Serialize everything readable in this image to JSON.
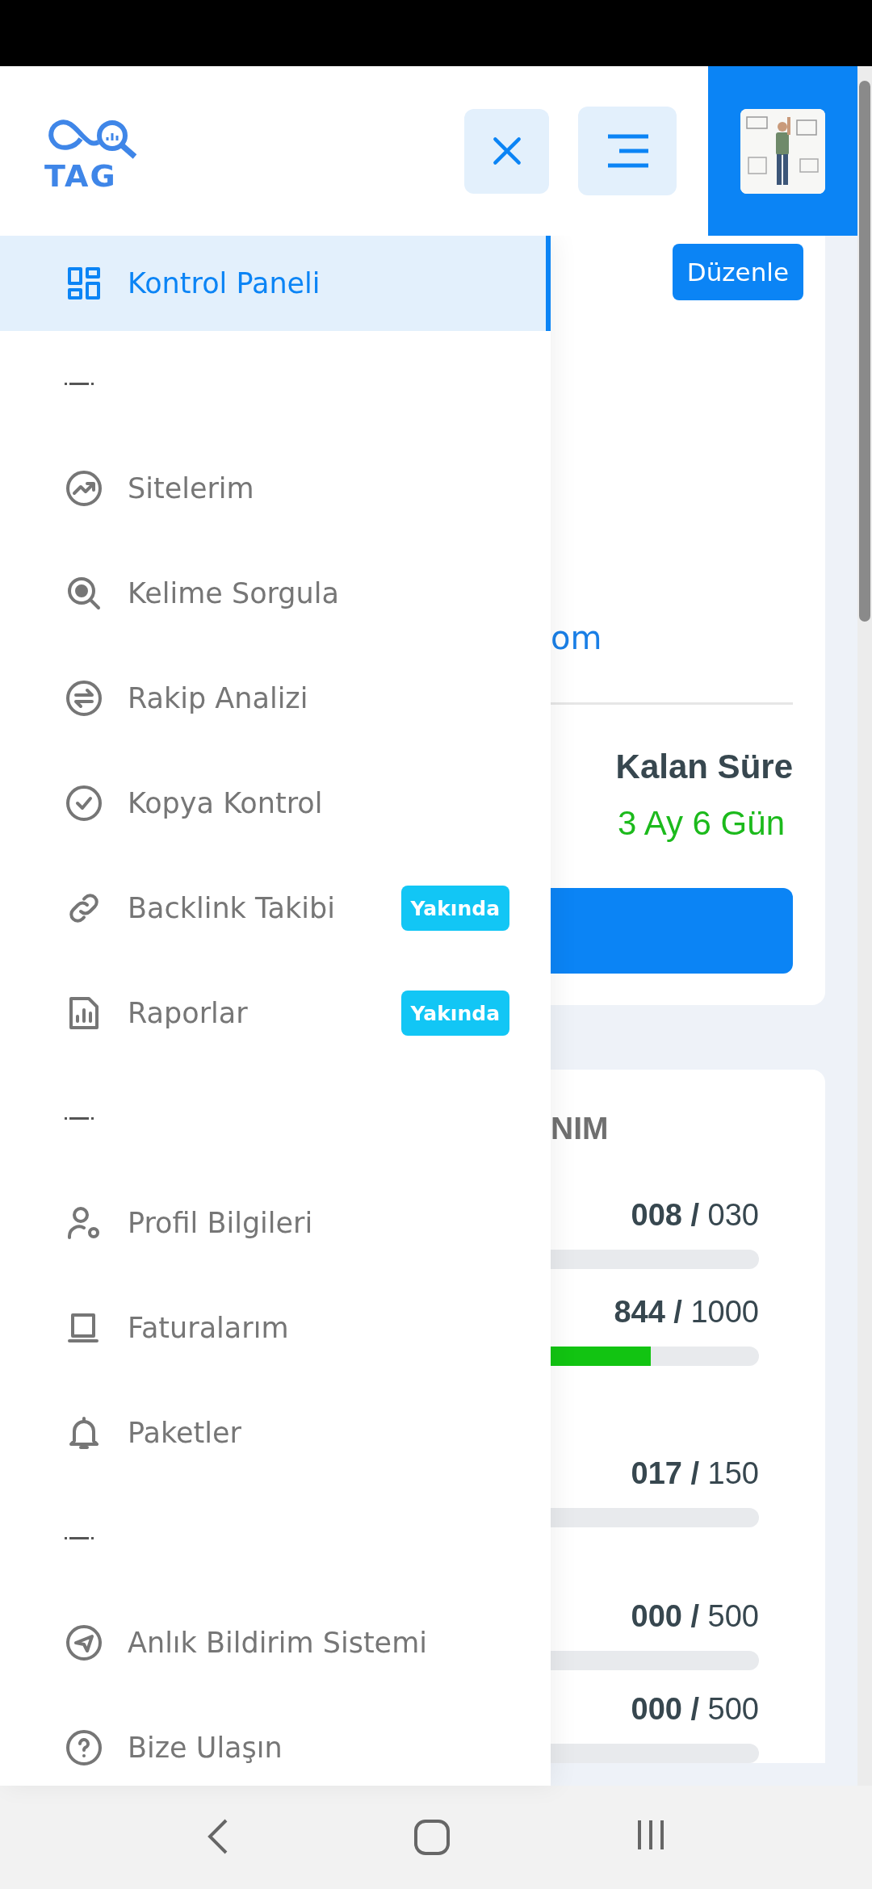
{
  "header": {
    "logo_text": "TAG"
  },
  "menu": [
    {
      "kind": "link",
      "label": "Kontrol Paneli",
      "selected": true
    },
    {
      "kind": "divider"
    },
    {
      "kind": "link",
      "label": "Sitelerim",
      "selected": false
    },
    {
      "kind": "link",
      "label": "Kelime Sorgula",
      "selected": false
    },
    {
      "kind": "link",
      "label": "Rakip Analizi",
      "selected": false
    },
    {
      "kind": "link",
      "label": "Kopya Kontrol",
      "selected": false
    },
    {
      "kind": "link",
      "label": "Backlink Takibi",
      "selected": false,
      "badge": "Yakında"
    },
    {
      "kind": "link",
      "label": "Raporlar",
      "selected": false,
      "badge": "Yakında"
    },
    {
      "kind": "divider"
    },
    {
      "kind": "link",
      "label": "Profil Bilgileri",
      "selected": false
    },
    {
      "kind": "link",
      "label": "Faturalarım",
      "selected": false
    },
    {
      "kind": "link",
      "label": "Paketler",
      "selected": false
    },
    {
      "kind": "divider"
    },
    {
      "kind": "link",
      "label": "Anlık Bildirim Sistemi",
      "selected": false
    },
    {
      "kind": "link",
      "label": "Bize Ulaşın",
      "selected": false
    }
  ],
  "site_card": {
    "edit_button": "Düzenle",
    "link_text": "om",
    "remaining_label": "Kalan Süre",
    "remaining_value": "3 Ay 6 Gün"
  },
  "usage_card": {
    "title": "NIM",
    "rows": [
      {
        "reading": "**008 /** 030"
      },
      {
        "reading": "**844 /** 1000"
      },
      {
        "reading": "**017 /** 150"
      },
      {
        "reading": "**000 /** 500"
      },
      {
        "reading": "**000 /** 500"
      }
    ]
  }
}
